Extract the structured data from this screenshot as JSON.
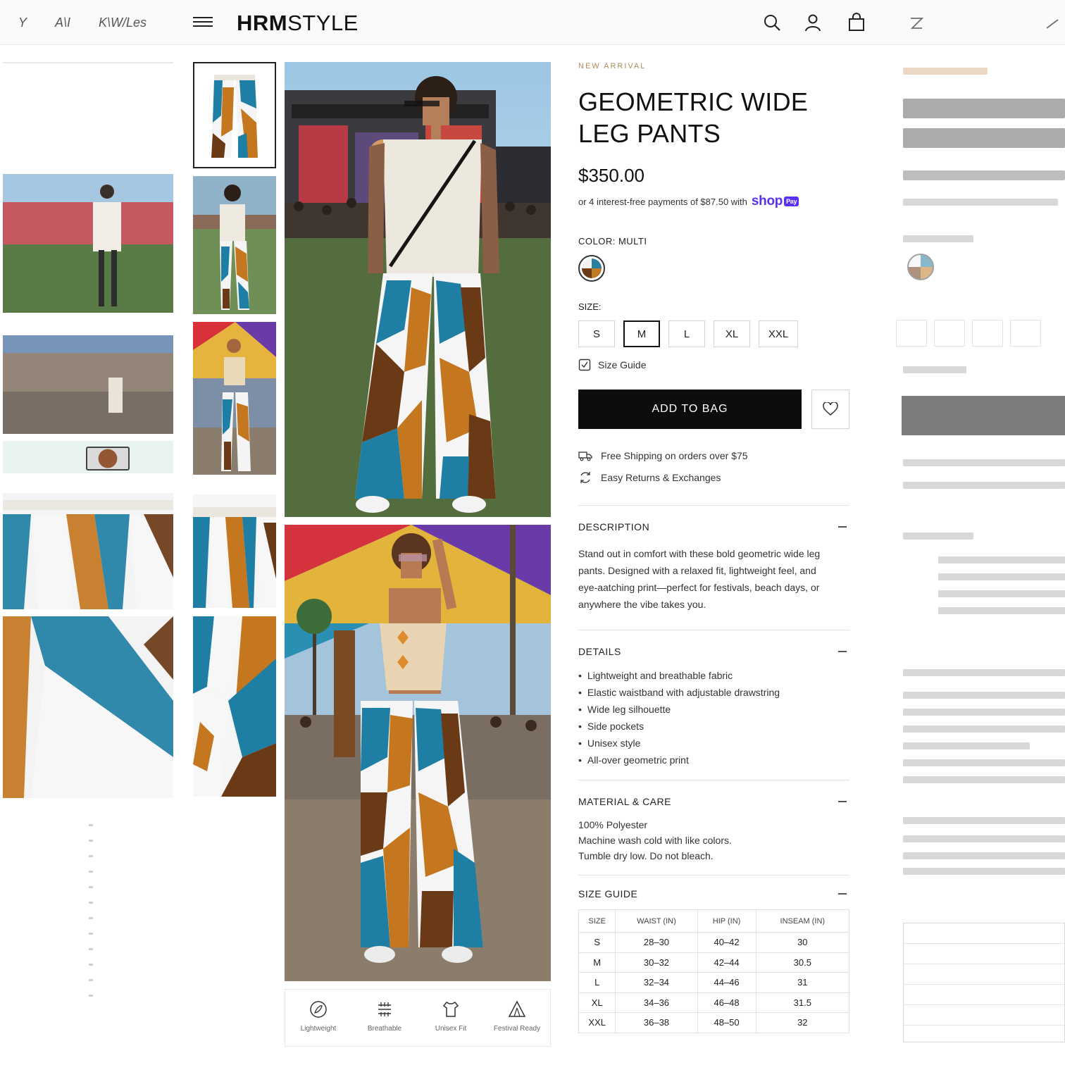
{
  "header": {
    "logo_bold": "HRM",
    "logo_light": "STYLE",
    "ghost_nav": [
      "Y",
      "A\\I",
      "K\\W/Les"
    ]
  },
  "product": {
    "tag": "NEW ARRIVAL",
    "title": "GEOMETRIC WIDE LEG PANTS",
    "price": "$350.00",
    "installments": "or 4 interest-free payments of $87.50 with",
    "shoppay": "shop",
    "shoppay_badge": "Pay",
    "color_label": "COLOR: MULTI",
    "size_label": "SIZE:",
    "sizes": [
      "S",
      "M",
      "L",
      "XL",
      "XXL"
    ],
    "selected_size": "M",
    "size_guide_link": "Size Guide",
    "add_to_bag": "ADD TO BAG",
    "perks": [
      "Free Shipping on orders over $75",
      "Easy Returns & Exchanges"
    ]
  },
  "description": {
    "heading": "DESCRIPTION",
    "text": "Stand out in comfort with these bold geometric wide leg pants. Designed with a relaxed fit, lightweight feel, and eye-aatching print—perfect for festivals, beach days, or anywhere the vibe takes you."
  },
  "details": {
    "heading": "DETAILS",
    "items": [
      "Lightweight and breathable fabric",
      "Elastic waistband with adjustable drawstring",
      "Wide leg silhouette",
      "Side pockets",
      "Unisex style",
      "All-over geometric print"
    ]
  },
  "care": {
    "heading": "MATERIAL & CARE",
    "lines": [
      "100% Polyester",
      "Machine wash cold with like colors.",
      "Tumble dry low. Do not bleach."
    ]
  },
  "size_guide": {
    "heading": "SIZE GUIDE",
    "columns": [
      "SIZE",
      "WAIST (IN)",
      "HIP (IN)",
      "INSEAM (IN)"
    ],
    "rows": [
      [
        "S",
        "28–30",
        "40–42",
        "30"
      ],
      [
        "M",
        "30–32",
        "42–44",
        "30.5"
      ],
      [
        "L",
        "32–34",
        "44–46",
        "31"
      ],
      [
        "XL",
        "34–36",
        "46–48",
        "31.5"
      ],
      [
        "XXL",
        "36–38",
        "48–50",
        "32"
      ]
    ]
  },
  "features": [
    {
      "icon": "feather-icon",
      "label": "Lightweight"
    },
    {
      "icon": "breathable-icon",
      "label": "Breathable"
    },
    {
      "icon": "unisex-fit-icon",
      "label": "Unisex Fit"
    },
    {
      "icon": "festival-tent-icon",
      "label": "Festival Ready"
    }
  ],
  "colors": {
    "button": "#0d0d0d",
    "tag": "#b08a5a",
    "shoppay": "#5a31f4",
    "print_blue": "#1f7ea3",
    "print_orange": "#c4771f",
    "print_brown": "#6a3a16"
  }
}
